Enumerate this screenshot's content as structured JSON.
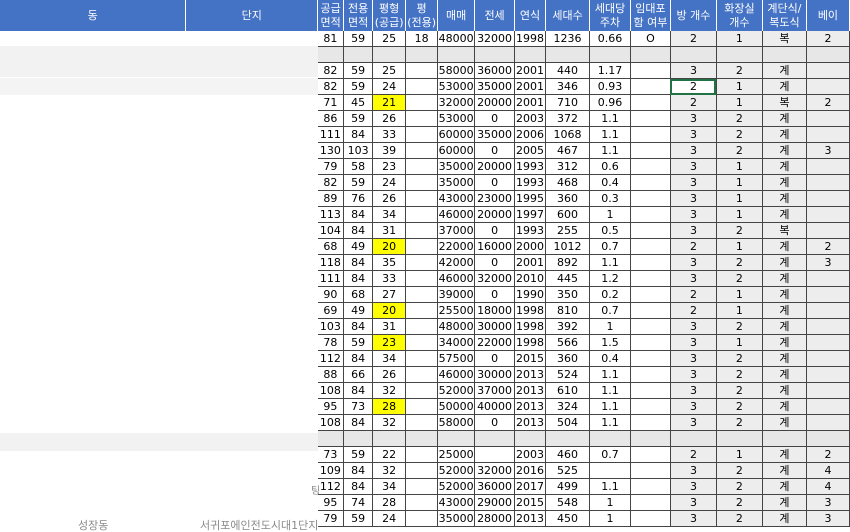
{
  "header": {
    "dong": "동",
    "danji": "단지",
    "supply_area": "공급\n면적",
    "excl_area": "전용\n면적",
    "pyeong_supply": "평형\n(공급)",
    "pyeong_excl": "평\n(전용)",
    "sale": "매매",
    "jeonse": "전세",
    "year": "연식",
    "households": "세대수",
    "parking": "세대당\n주차",
    "rental": "임대포\n함 여부",
    "rooms": "방 개수",
    "baths": "화장실\n개수",
    "type": "계단식/\n복도식",
    "bay": "베이"
  },
  "partial_text": {
    "left_clip_1": "팅",
    "left_bottom": "성장동",
    "danji_bottom": "서귀포에인전도시대1단지"
  },
  "rows": [
    {
      "s": "81",
      "e": "59",
      "p": "25",
      "pe": "18",
      "sale": "48000",
      "j": "32000",
      "y": "1998",
      "h": "1236",
      "pk": "0.66",
      "r": "O",
      "rm": "2",
      "bt": "1",
      "t": "복",
      "b": "2"
    },
    {
      "blank": true
    },
    {
      "s": "82",
      "e": "59",
      "p": "25",
      "pe": "",
      "sale": "58000",
      "j": "36000",
      "y": "2001",
      "h": "440",
      "pk": "1.17",
      "r": "",
      "rm": "3",
      "bt": "2",
      "t": "계",
      "b": ""
    },
    {
      "s": "82",
      "e": "59",
      "p": "24",
      "pe": "",
      "sale": "53000",
      "j": "35000",
      "y": "2001",
      "h": "346",
      "pk": "0.93",
      "r": "",
      "rm": "2",
      "bt": "1",
      "t": "계",
      "b": "",
      "sel": true
    },
    {
      "s": "71",
      "e": "45",
      "p": "21",
      "pe": "",
      "sale": "32000",
      "j": "20000",
      "y": "2001",
      "h": "710",
      "pk": "0.96",
      "r": "",
      "rm": "2",
      "bt": "1",
      "t": "복",
      "b": "2",
      "yl": true
    },
    {
      "s": "86",
      "e": "59",
      "p": "26",
      "pe": "",
      "sale": "53000",
      "j": "0",
      "y": "2003",
      "h": "372",
      "pk": "1.1",
      "r": "",
      "rm": "3",
      "bt": "2",
      "t": "계",
      "b": ""
    },
    {
      "s": "111",
      "e": "84",
      "p": "33",
      "pe": "",
      "sale": "60000",
      "j": "35000",
      "y": "2006",
      "h": "1068",
      "pk": "1.1",
      "r": "",
      "rm": "3",
      "bt": "2",
      "t": "계",
      "b": ""
    },
    {
      "s": "130",
      "e": "103",
      "p": "39",
      "pe": "",
      "sale": "60000",
      "j": "0",
      "y": "2005",
      "h": "467",
      "pk": "1.1",
      "r": "",
      "rm": "3",
      "bt": "2",
      "t": "계",
      "b": "3"
    },
    {
      "s": "79",
      "e": "58",
      "p": "23",
      "pe": "",
      "sale": "35000",
      "j": "20000",
      "y": "1993",
      "h": "312",
      "pk": "0.6",
      "r": "",
      "rm": "3",
      "bt": "1",
      "t": "계",
      "b": ""
    },
    {
      "s": "82",
      "e": "59",
      "p": "24",
      "pe": "",
      "sale": "35000",
      "j": "0",
      "y": "1993",
      "h": "468",
      "pk": "0.4",
      "r": "",
      "rm": "3",
      "bt": "1",
      "t": "계",
      "b": ""
    },
    {
      "s": "89",
      "e": "76",
      "p": "26",
      "pe": "",
      "sale": "43000",
      "j": "23000",
      "y": "1995",
      "h": "360",
      "pk": "0.3",
      "r": "",
      "rm": "3",
      "bt": "1",
      "t": "계",
      "b": ""
    },
    {
      "s": "113",
      "e": "84",
      "p": "34",
      "pe": "",
      "sale": "46000",
      "j": "20000",
      "y": "1997",
      "h": "600",
      "pk": "1",
      "r": "",
      "rm": "3",
      "bt": "1",
      "t": "계",
      "b": ""
    },
    {
      "s": "104",
      "e": "84",
      "p": "31",
      "pe": "",
      "sale": "37000",
      "j": "0",
      "y": "1993",
      "h": "255",
      "pk": "0.5",
      "r": "",
      "rm": "3",
      "bt": "2",
      "t": "복",
      "b": ""
    },
    {
      "s": "68",
      "e": "49",
      "p": "20",
      "pe": "",
      "sale": "22000",
      "j": "16000",
      "y": "2000",
      "h": "1012",
      "pk": "0.7",
      "r": "",
      "rm": "2",
      "bt": "1",
      "t": "계",
      "b": "2",
      "yl": true
    },
    {
      "s": "118",
      "e": "84",
      "p": "35",
      "pe": "",
      "sale": "42000",
      "j": "0",
      "y": "2001",
      "h": "892",
      "pk": "1.1",
      "r": "",
      "rm": "3",
      "bt": "2",
      "t": "계",
      "b": "3"
    },
    {
      "s": "111",
      "e": "84",
      "p": "33",
      "pe": "",
      "sale": "46000",
      "j": "32000",
      "y": "2010",
      "h": "445",
      "pk": "1.2",
      "r": "",
      "rm": "3",
      "bt": "2",
      "t": "계",
      "b": ""
    },
    {
      "s": "90",
      "e": "68",
      "p": "27",
      "pe": "",
      "sale": "39000",
      "j": "0",
      "y": "1990",
      "h": "350",
      "pk": "0.2",
      "r": "",
      "rm": "2",
      "bt": "1",
      "t": "계",
      "b": ""
    },
    {
      "s": "69",
      "e": "49",
      "p": "20",
      "pe": "",
      "sale": "25500",
      "j": "18000",
      "y": "1998",
      "h": "810",
      "pk": "0.7",
      "r": "",
      "rm": "2",
      "bt": "1",
      "t": "계",
      "b": "",
      "yl": true
    },
    {
      "s": "103",
      "e": "84",
      "p": "31",
      "pe": "",
      "sale": "48000",
      "j": "30000",
      "y": "1998",
      "h": "392",
      "pk": "1",
      "r": "",
      "rm": "3",
      "bt": "2",
      "t": "계",
      "b": ""
    },
    {
      "s": "78",
      "e": "59",
      "p": "23",
      "pe": "",
      "sale": "34000",
      "j": "22000",
      "y": "1998",
      "h": "566",
      "pk": "1.5",
      "r": "",
      "rm": "3",
      "bt": "1",
      "t": "계",
      "b": "",
      "yl": true
    },
    {
      "s": "112",
      "e": "84",
      "p": "34",
      "pe": "",
      "sale": "57500",
      "j": "0",
      "y": "2015",
      "h": "360",
      "pk": "0.4",
      "r": "",
      "rm": "3",
      "bt": "2",
      "t": "계",
      "b": ""
    },
    {
      "s": "88",
      "e": "66",
      "p": "26",
      "pe": "",
      "sale": "46000",
      "j": "30000",
      "y": "2013",
      "h": "524",
      "pk": "1.1",
      "r": "",
      "rm": "3",
      "bt": "2",
      "t": "계",
      "b": ""
    },
    {
      "s": "108",
      "e": "84",
      "p": "32",
      "pe": "",
      "sale": "52000",
      "j": "37000",
      "y": "2013",
      "h": "610",
      "pk": "1.1",
      "r": "",
      "rm": "3",
      "bt": "2",
      "t": "계",
      "b": ""
    },
    {
      "s": "95",
      "e": "73",
      "p": "28",
      "pe": "",
      "sale": "50000",
      "j": "40000",
      "y": "2013",
      "h": "324",
      "pk": "1.1",
      "r": "",
      "rm": "3",
      "bt": "2",
      "t": "계",
      "b": "",
      "yl": true
    },
    {
      "s": "108",
      "e": "84",
      "p": "32",
      "pe": "",
      "sale": "58000",
      "j": "0",
      "y": "2013",
      "h": "504",
      "pk": "1.1",
      "r": "",
      "rm": "3",
      "bt": "2",
      "t": "계",
      "b": ""
    },
    {
      "blank": true
    },
    {
      "s": "73",
      "e": "59",
      "p": "22",
      "pe": "",
      "sale": "25000",
      "j": "",
      "y": "2003",
      "h": "460",
      "pk": "0.7",
      "r": "",
      "rm": "2",
      "bt": "1",
      "t": "계",
      "b": "2"
    },
    {
      "s": "109",
      "e": "84",
      "p": "32",
      "pe": "",
      "sale": "52000",
      "j": "32000",
      "y": "2016",
      "h": "525",
      "pk": "",
      "r": "",
      "rm": "3",
      "bt": "2",
      "t": "계",
      "b": "4"
    },
    {
      "s": "112",
      "e": "84",
      "p": "34",
      "pe": "",
      "sale": "52000",
      "j": "36000",
      "y": "2017",
      "h": "499",
      "pk": "1.1",
      "r": "",
      "rm": "3",
      "bt": "2",
      "t": "계",
      "b": "4"
    },
    {
      "s": "95",
      "e": "74",
      "p": "28",
      "pe": "",
      "sale": "43000",
      "j": "29000",
      "y": "2015",
      "h": "548",
      "pk": "1",
      "r": "",
      "rm": "3",
      "bt": "2",
      "t": "계",
      "b": "3"
    },
    {
      "s": "79",
      "e": "59",
      "p": "24",
      "pe": "",
      "sale": "35000",
      "j": "28000",
      "y": "2013",
      "h": "450",
      "pk": "1",
      "r": "",
      "rm": "3",
      "bt": "2",
      "t": "계",
      "b": "3"
    }
  ]
}
